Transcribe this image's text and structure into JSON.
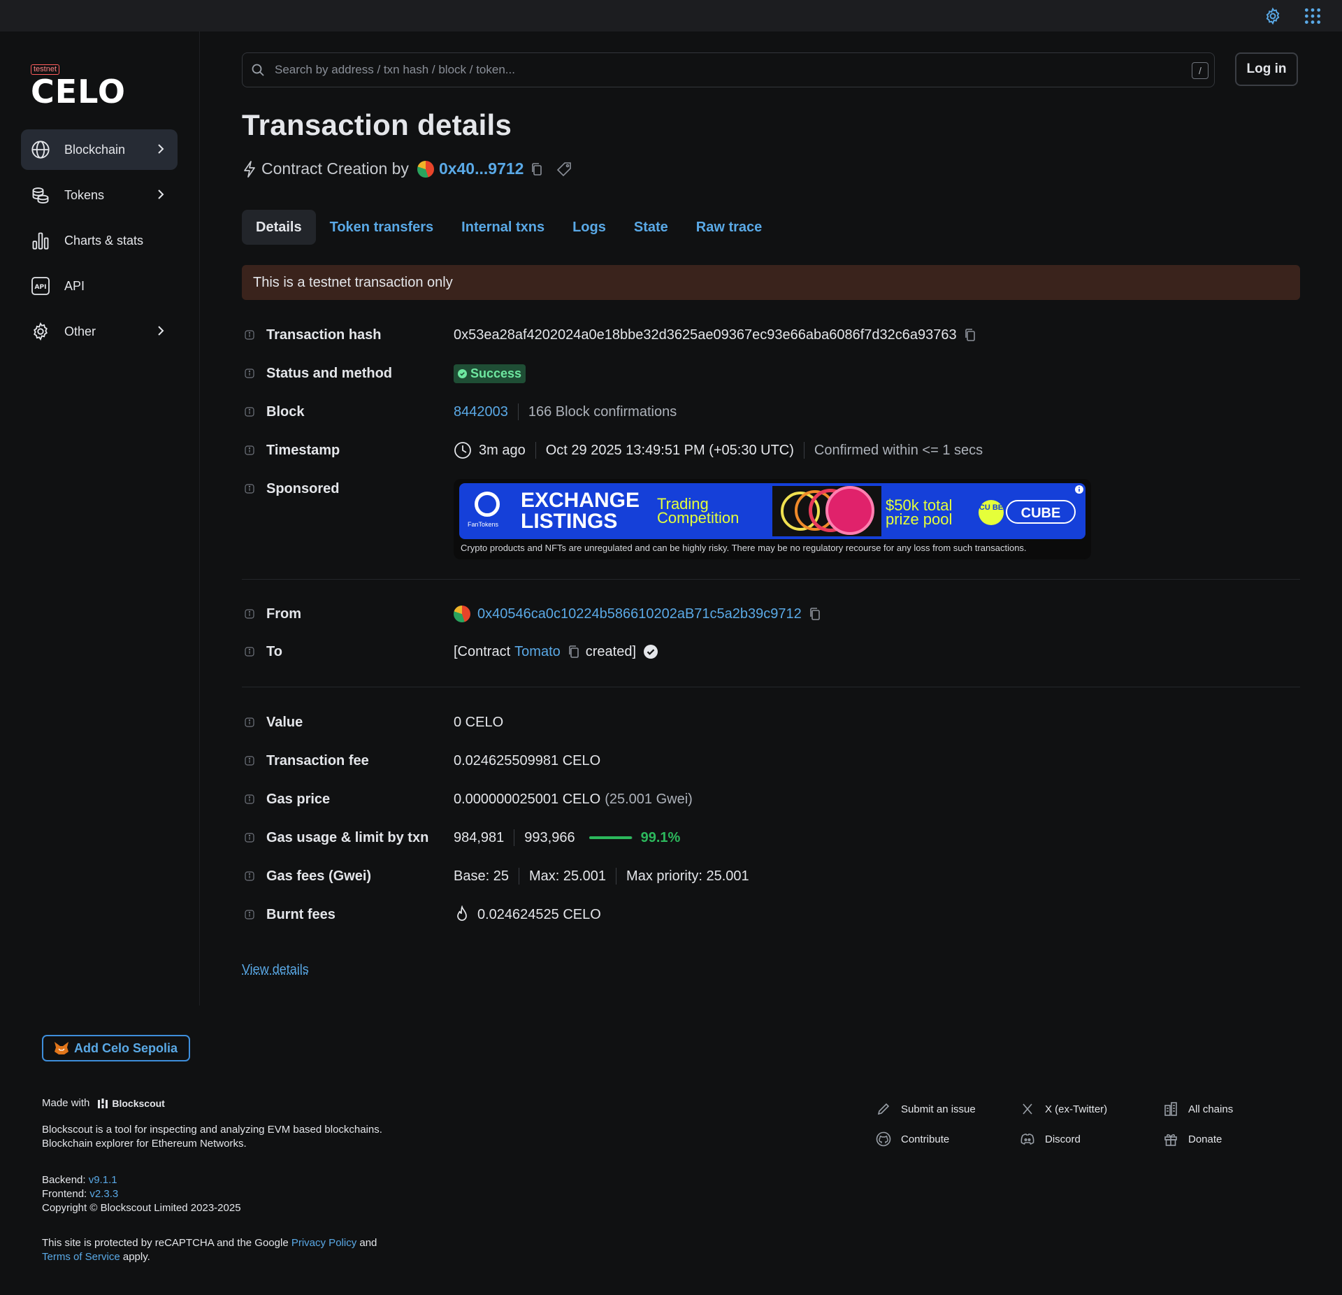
{
  "header": {
    "settings_icon": "gear-icon",
    "apps_icon": "grid-icon"
  },
  "brand": {
    "badge": "testnet",
    "name": "CELO"
  },
  "sidebar": {
    "items": [
      {
        "label": "Blockchain",
        "icon": "globe-icon",
        "active": true,
        "has_submenu": true
      },
      {
        "label": "Tokens",
        "icon": "coins-icon",
        "has_submenu": true
      },
      {
        "label": "Charts & stats",
        "icon": "bar-chart-icon"
      },
      {
        "label": "API",
        "icon": "api-icon"
      },
      {
        "label": "Other",
        "icon": "gear-icon",
        "has_submenu": true
      }
    ]
  },
  "search": {
    "placeholder": "Search by address / txn hash / block / token...",
    "shortcut": "/"
  },
  "auth": {
    "login_label": "Log in"
  },
  "page": {
    "title": "Transaction details",
    "subtitle_prefix": "Contract Creation by",
    "creator_short": "0x40...9712"
  },
  "tabs": [
    "Details",
    "Token transfers",
    "Internal txns",
    "Logs",
    "State",
    "Raw trace"
  ],
  "alert": "This is a testnet transaction only",
  "details": {
    "tx_hash": {
      "label": "Transaction hash",
      "value": "0x53ea28af4202024a0e18bbe32d3625ae09367ec93e66aba6086f7d32c6a93763"
    },
    "status": {
      "label": "Status and method",
      "value": "Success"
    },
    "block": {
      "label": "Block",
      "number": "8442003",
      "confirmations": "166 Block confirmations"
    },
    "timestamp": {
      "label": "Timestamp",
      "ago": "3m ago",
      "datetime": "Oct 29 2025 13:49:51 PM (+05:30 UTC)",
      "confirmed": "Confirmed within <= 1 secs"
    },
    "sponsored": {
      "label": "Sponsored",
      "ad_brand": "FanTokens",
      "ad_title_1": "EXCHANGE",
      "ad_title_2": "LISTINGS",
      "ad_sub_1": "Trading",
      "ad_sub_2": "Competition",
      "ad_prize_1": "$50k total",
      "ad_prize_2": "prize pool",
      "ad_cube_small": "CU BE",
      "ad_cube": "CUBE",
      "ad_disclaimer": "Crypto products and NFTs are unregulated and can be highly risky. There may be no regulatory recourse for any loss from such transactions."
    },
    "from": {
      "label": "From",
      "address": "0x40546ca0c10224b586610202aB71c5a2b39c9712"
    },
    "to": {
      "label": "To",
      "prefix": "[Contract",
      "name": "Tomato",
      "suffix": "created]"
    },
    "value": {
      "label": "Value",
      "value": "0 CELO"
    },
    "fee": {
      "label": "Transaction fee",
      "value": "0.024625509981 CELO"
    },
    "gas_price": {
      "label": "Gas price",
      "value": "0.000000025001 CELO",
      "gwei": "(25.001 Gwei)"
    },
    "gas_usage": {
      "label": "Gas usage & limit by txn",
      "used": "984,981",
      "limit": "993,966",
      "percent": "99.1%",
      "percent_value": 99.1
    },
    "gas_fees": {
      "label": "Gas fees (Gwei)",
      "base": "Base: 25",
      "max": "Max: 25.001",
      "max_priority": "Max priority: 25.001"
    },
    "burnt": {
      "label": "Burnt fees",
      "value": "0.024624525 CELO"
    },
    "view_details": "View details"
  },
  "footer": {
    "add_network": "Add Celo Sepolia",
    "made_with": "Made with",
    "made_with_brand": "Blockscout",
    "desc_1": "Blockscout is a tool for inspecting and analyzing EVM based blockchains.",
    "desc_2": "Blockchain explorer for Ethereum Networks.",
    "backend_label": "Backend:",
    "backend_version": "v9.1.1",
    "frontend_label": "Frontend:",
    "frontend_version": "v2.3.3",
    "copyright": "Copyright © Blockscout Limited 2023-2025",
    "recaptcha_1": "This site is protected by reCAPTCHA and the Google",
    "privacy": "Privacy Policy",
    "and": "and",
    "terms": "Terms of Service",
    "apply": "apply.",
    "links": [
      {
        "label": "Submit an issue",
        "icon": "pencil-icon"
      },
      {
        "label": "X (ex-Twitter)",
        "icon": "x-icon"
      },
      {
        "label": "All chains",
        "icon": "buildings-icon"
      },
      {
        "label": "Contribute",
        "icon": "github-icon"
      },
      {
        "label": "Discord",
        "icon": "discord-icon"
      },
      {
        "label": "Donate",
        "icon": "gift-icon"
      }
    ]
  },
  "colors": {
    "accent": "#5aa9e6",
    "success": "#6ee7a0",
    "alert_bg": "#3a231c",
    "bg": "#101112"
  }
}
